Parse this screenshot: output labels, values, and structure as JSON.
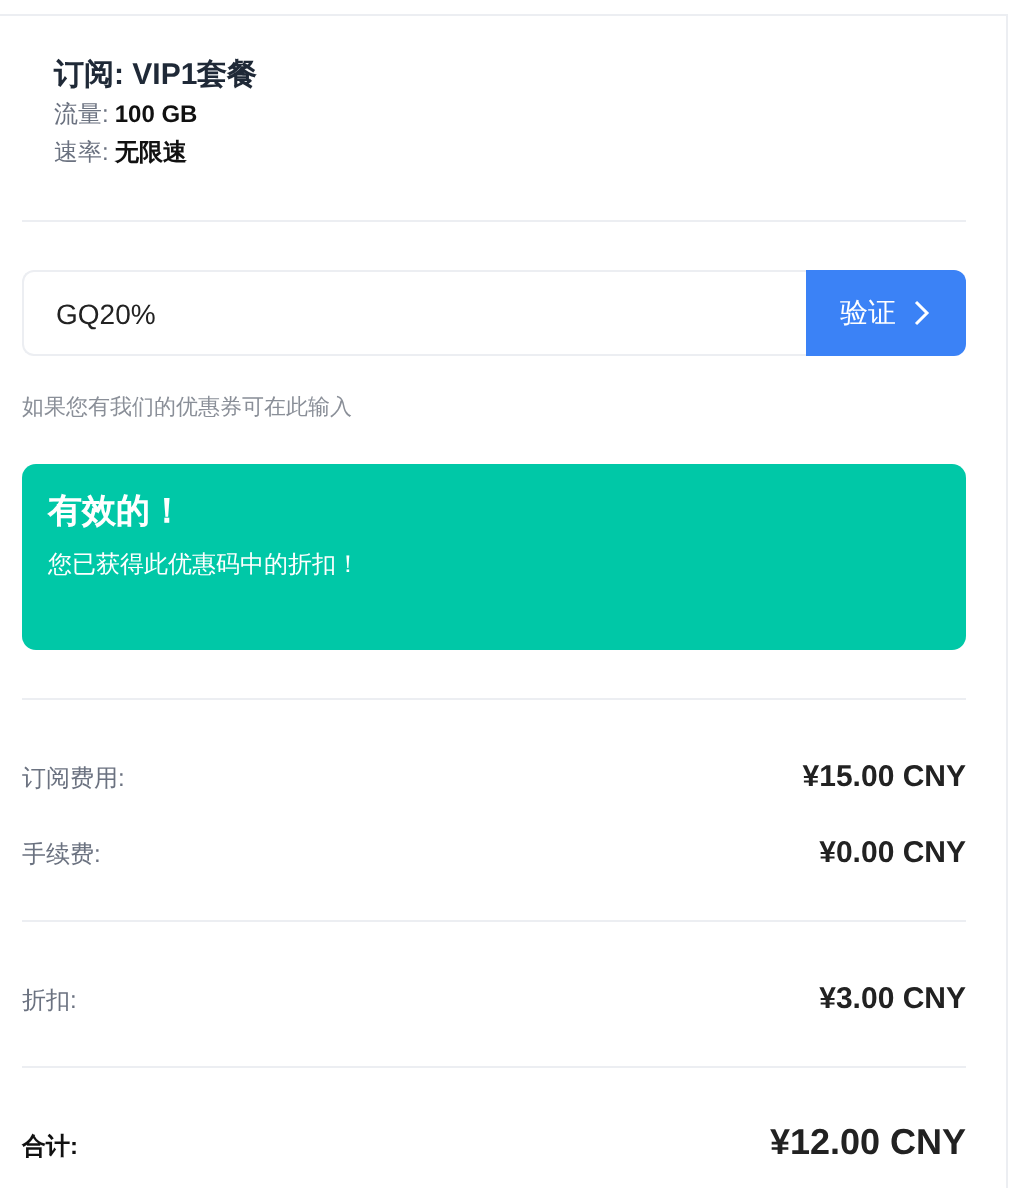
{
  "plan": {
    "title": "订阅: VIP1套餐",
    "specs": [
      {
        "label": "流量:",
        "value": "100 GB"
      },
      {
        "label": "速率:",
        "value": "无限速"
      }
    ]
  },
  "coupon": {
    "value": "GQ20%",
    "button": "验证",
    "hint": "如果您有我们的优惠券可在此输入"
  },
  "alert": {
    "kind": "success",
    "title": "有效的！",
    "message": "您已获得此优惠码中的折扣！"
  },
  "summary": [
    [
      {
        "label": "订阅费用:",
        "amount": "¥15.00 CNY"
      },
      {
        "label": "手续费:",
        "amount": "¥0.00 CNY"
      }
    ],
    [
      {
        "label": "折扣:",
        "amount": "¥3.00 CNY"
      }
    ]
  ],
  "total": {
    "label": "合计:",
    "amount": "¥12.00 CNY"
  }
}
